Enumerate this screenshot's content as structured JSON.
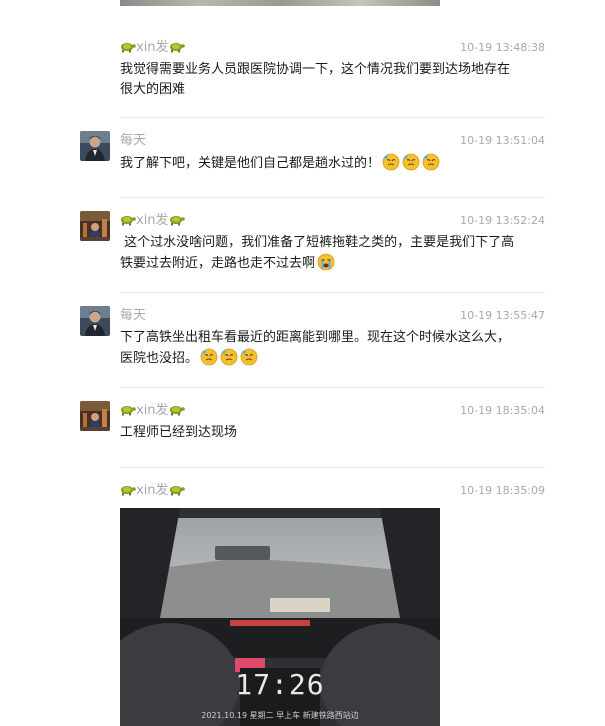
{
  "messages": [
    {
      "sender": "xin发",
      "time": "10-19 13:48:38",
      "text": "我觉得需要业务人员跟医院协调一下，这个情况我们要到达场地存在很大的困难",
      "emoji": []
    },
    {
      "sender": "每天",
      "time": "10-19 13:51:04",
      "text": "我了解下吧，关键是他们自己都是趟水过的！",
      "emoji": [
        "sweat-face-emoji",
        "sweat-face-emoji",
        "sweat-face-emoji"
      ]
    },
    {
      "sender": "xin发",
      "time": "10-19 13:52:24",
      "text": " 这个过水没啥问题，我们准备了短裤拖鞋之类的，主要是我们下了高铁要过去附近，走路也走不过去啊",
      "emoji": [
        "crying-face-emoji"
      ]
    },
    {
      "sender": "每天",
      "time": "10-19 13:55:47",
      "text": "下了高铁坐出租车看最近的距离能到哪里。现在这个时候水这么大，医院也没招。",
      "emoji": [
        "sweat-face-emoji",
        "sweat-face-emoji",
        "sweat-face-emoji"
      ]
    },
    {
      "sender": "xin发",
      "time": "10-19 18:35:04",
      "text": "工程师已经到达现场",
      "emoji": []
    },
    {
      "sender": "xin发",
      "time": "10-19 18:35:09",
      "text": "",
      "emoji": []
    }
  ],
  "photo": {
    "clock": "17:26",
    "caption": "2021.10.19  星期二  早上车 新建铁路西站边"
  },
  "icons": {
    "name_decoration": "turtle-icon"
  }
}
